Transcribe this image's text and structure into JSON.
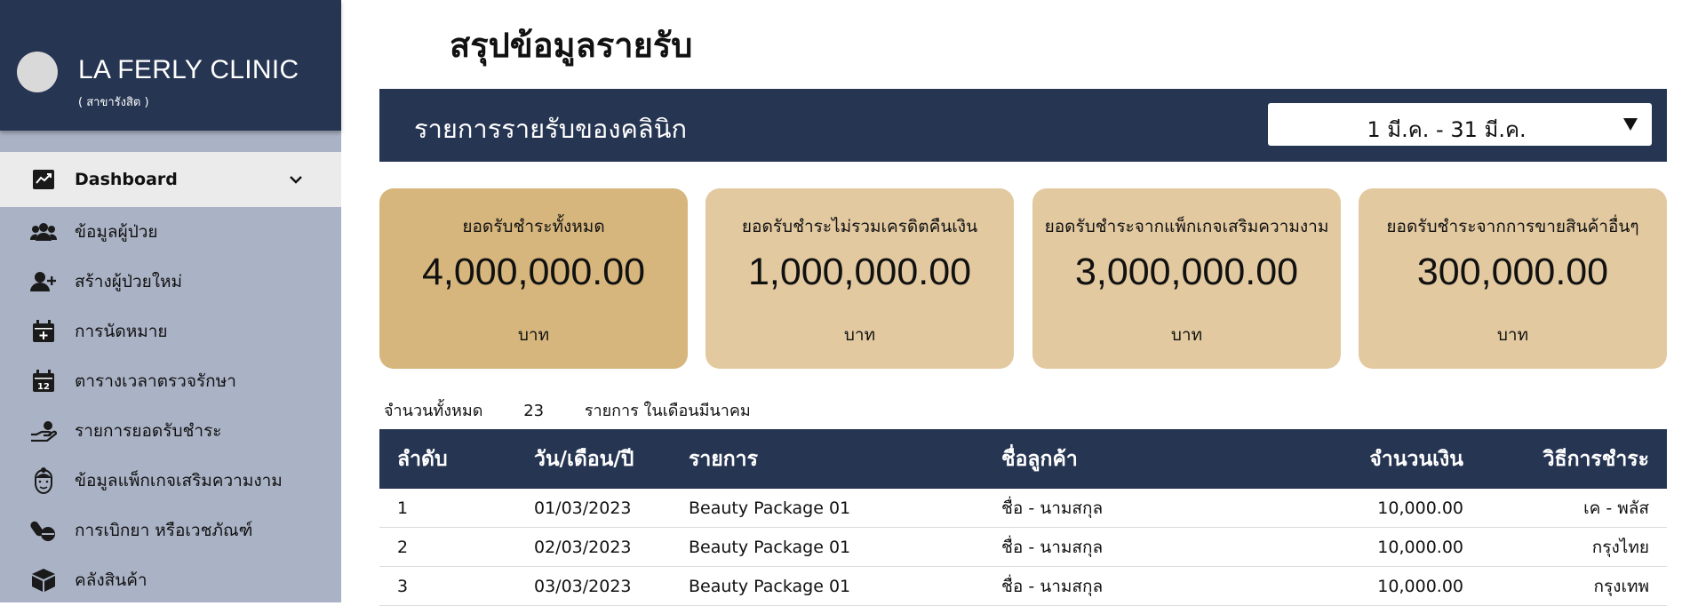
{
  "brand": {
    "name": "LA FERLY CLINIC",
    "branch": "( สาขารังสิต )"
  },
  "sidebar": {
    "items": [
      {
        "label": "Dashboard",
        "icon": "chart-icon",
        "active": true
      },
      {
        "label": "ข้อมูลผู้ป่วย",
        "icon": "users-icon"
      },
      {
        "label": "สร้างผู้ป่วยใหม่",
        "icon": "add-user-icon"
      },
      {
        "label": "การนัดหมาย",
        "icon": "calendar-plus-icon"
      },
      {
        "label": "ตารางเวลาตรวจรักษา",
        "icon": "calendar-12-icon"
      },
      {
        "label": "รายการยอดรับชำระ",
        "icon": "hand-coin-icon"
      },
      {
        "label": "ข้อมูลแพ็กเกจเสริมความงาม",
        "icon": "beauty-face-icon"
      },
      {
        "label": "การเบิกยา หรือเวชภัณฑ์",
        "icon": "pills-icon"
      },
      {
        "label": "คลังสินค้า",
        "icon": "box-icon"
      }
    ]
  },
  "page": {
    "title": "สรุปข้อมูลรายรับ"
  },
  "banner": {
    "title": "รายการรายรับของคลินิก",
    "date_range": "1 มี.ค. - 31 มี.ค."
  },
  "cards": [
    {
      "label": "ยอดรับชำระทั้งหมด",
      "value": "4,000,000.00",
      "unit": "บาท"
    },
    {
      "label": "ยอดรับชำระไม่รวมเครดิตคืนเงิน",
      "value": "1,000,000.00",
      "unit": "บาท"
    },
    {
      "label": "ยอดรับชำระจากแพ็กเกจเสริมความงาม",
      "value": "3,000,000.00",
      "unit": "บาท"
    },
    {
      "label": "ยอดรับชำระจากการขายสินค้าอื่นๆ",
      "value": "300,000.00",
      "unit": "บาท"
    }
  ],
  "summary": {
    "prefix": "จำนวนทั้งหมด",
    "count": "23",
    "suffix": "รายการ ในเดือนมีนาคม"
  },
  "table": {
    "headers": [
      "ลำดับ",
      "วัน/เดือน/ปี",
      "รายการ",
      "ชื่อลูกค้า",
      "จำนวนเงิน",
      "วิธีการชำระ"
    ],
    "rows": [
      [
        "1",
        "01/03/2023",
        "Beauty Package 01",
        "ชื่อ - นามสกุล",
        "10,000.00",
        "เค - พลัส"
      ],
      [
        "2",
        "02/03/2023",
        "Beauty Package 01",
        "ชื่อ - นามสกุล",
        "10,000.00",
        "กรุงไทย"
      ],
      [
        "3",
        "03/03/2023",
        "Beauty Package 01",
        "ชื่อ - นามสกุล",
        "10,000.00",
        "กรุงเทพ"
      ]
    ]
  },
  "colors": {
    "navy": "#263552",
    "sidebar": "#aab2c5",
    "card": "#e2c9a0",
    "card_primary": "#d6b67c"
  }
}
